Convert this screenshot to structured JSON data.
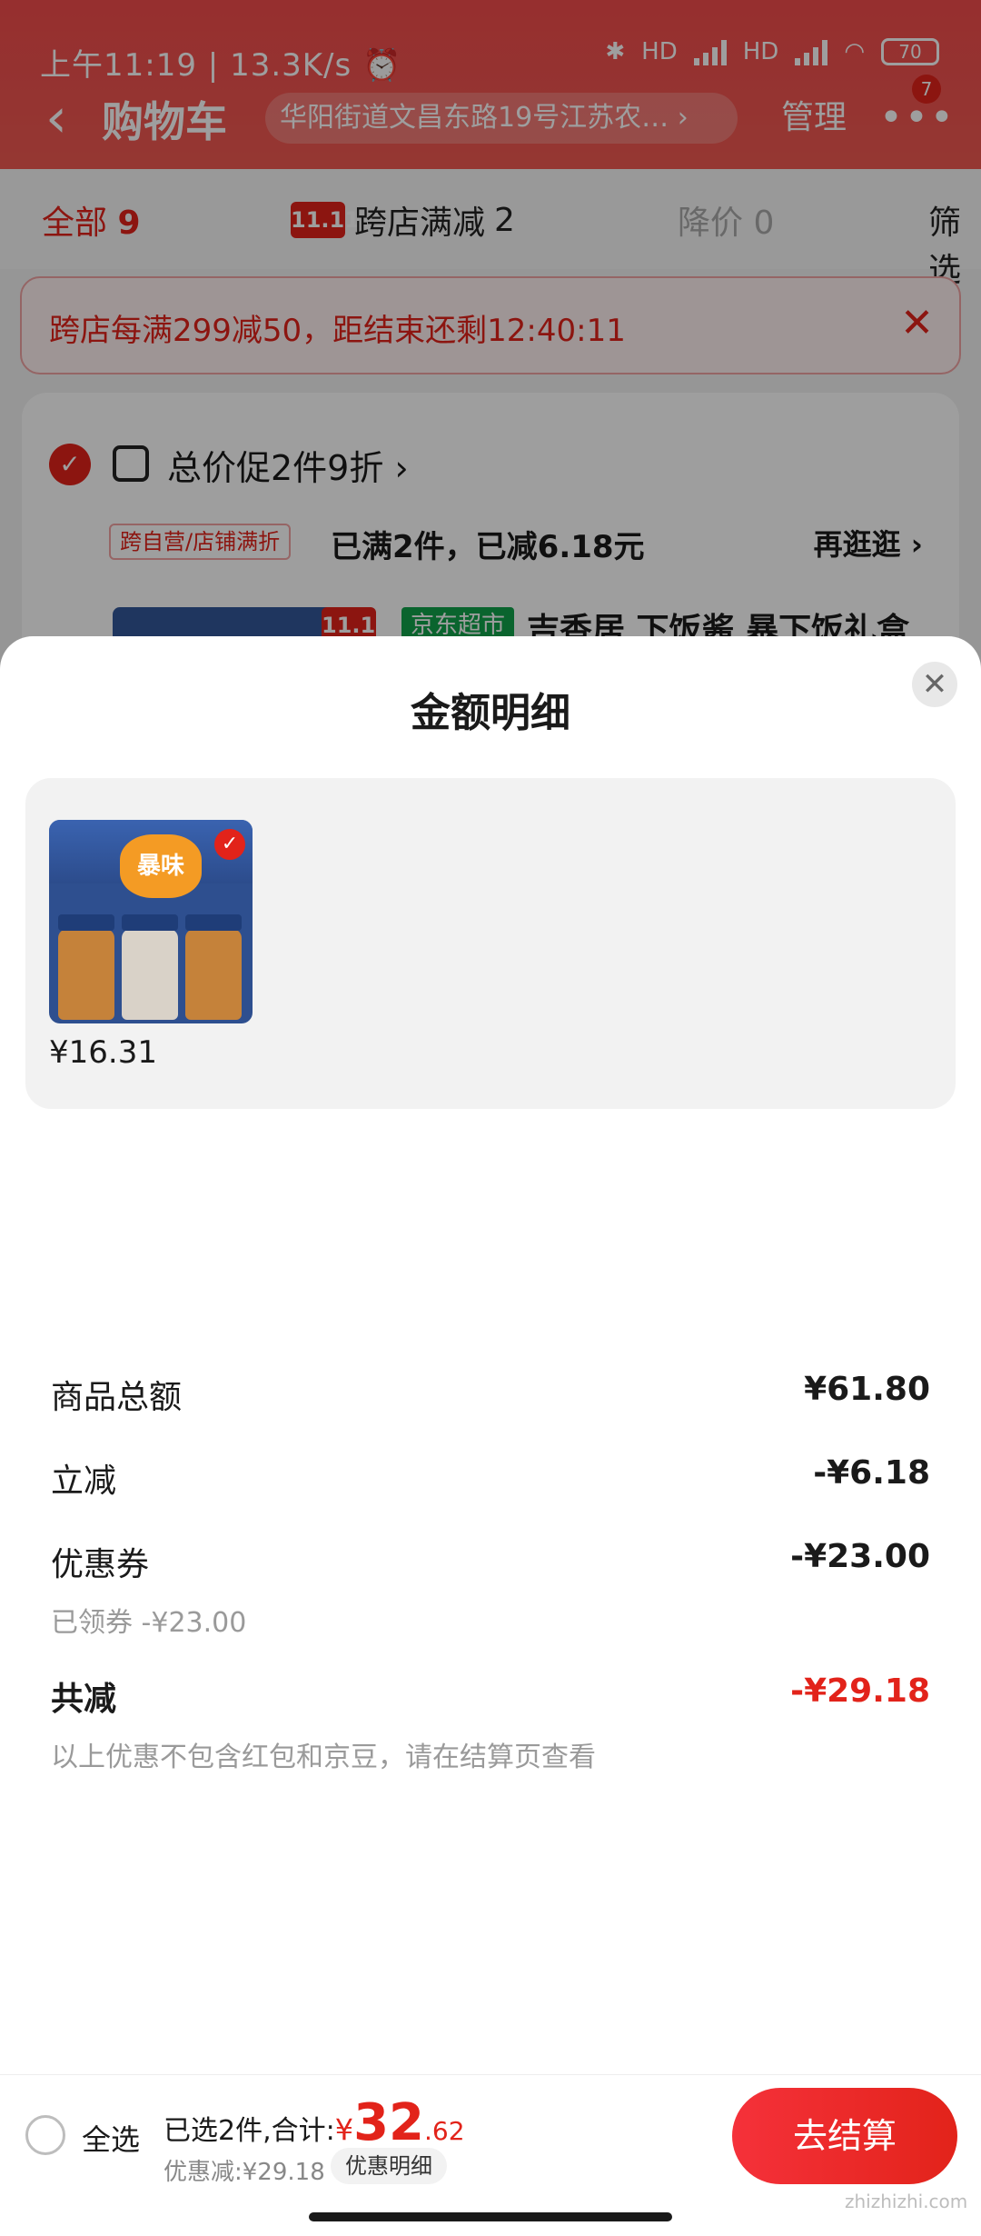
{
  "status_bar": {
    "time": "上午11:19",
    "net_speed": "13.3K/s",
    "hd1": "HD",
    "hd2": "HD",
    "battery": "70"
  },
  "header": {
    "back_icon": "chevron-left-icon",
    "title": "购物车",
    "address": "华阳街道文昌东路19号江苏农…",
    "manage": "管理",
    "more_icon": "more-dots-icon",
    "more_badge": "7"
  },
  "tabs": {
    "all_label": "全部",
    "all_count": "9",
    "cross_logo": "11.11",
    "cross_label": "跨店满减",
    "cross_count": "2",
    "drop_label": "降价",
    "drop_count": "0",
    "filter_label": "筛选"
  },
  "banner": {
    "text": "跨店每满299减50，距结束还剩12:40:11",
    "close_icon": "close-icon"
  },
  "store": {
    "promo_title": "总价促2件9折",
    "promo_tag": "跨自营/店铺满折",
    "promo_desc": "已满2件，已减6.18元",
    "promo_more": "再逛逛 ›",
    "product_tag": "京东超市",
    "product_title": "吉香居 下饭酱 暴下饭礼盒",
    "product_logo": "11.11"
  },
  "sheet": {
    "title": "金额明细",
    "close_icon": "close-icon",
    "item_price": "¥16.31",
    "thumb_burst": "暴味",
    "rows": [
      {
        "label": "商品总额",
        "value": "¥61.80"
      },
      {
        "label": "立减",
        "value": "-¥6.18"
      },
      {
        "label": "优惠券",
        "value": "-¥23.00"
      }
    ],
    "coupon_sub": "已领券 -¥23.00",
    "total_label": "共减",
    "total_value": "-¥29.18",
    "note": "以上优惠不包含红包和京豆，请在结算页查看"
  },
  "bottom_bar": {
    "select_all": "全选",
    "selected_text": "已选2件,合计:",
    "currency": "¥",
    "price_int": "32",
    "price_dec": ".62",
    "discount_text": "优惠减:¥29.18",
    "discount_detail": "优惠明细",
    "checkout": "去结算"
  },
  "watermark": "zhizhizhi.com",
  "colors": {
    "accent": "#e2231a",
    "header_bg": "#f24c4c",
    "sheet_bg": "#ffffff",
    "panel_bg": "#f2f2f2"
  }
}
